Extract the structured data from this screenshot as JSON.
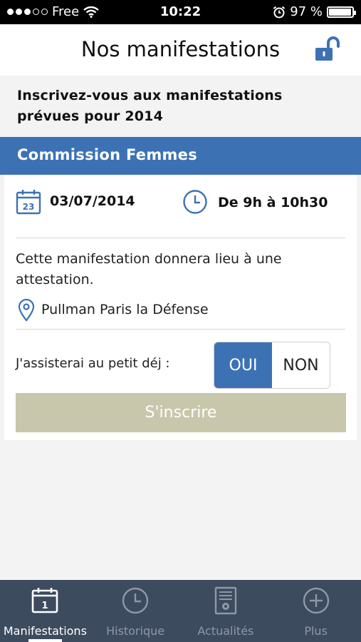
{
  "status_bar": {
    "carrier": "Free",
    "time": "10:22",
    "battery": "97 %",
    "battery_level": 0.97
  },
  "header": {
    "title": "Nos manifestations"
  },
  "intro": {
    "text": "Inscrivez-vous aux manifestations prévues pour 2014"
  },
  "section": {
    "title": "Commission Femmes"
  },
  "event": {
    "date_icon_day": "23",
    "date": "03/07/2014",
    "time": "De 9h à 10h30",
    "description": "Cette manifestation donnera lieu à une attestation.",
    "location": "Pullman Paris la Défense",
    "breakfast_label": "J'assisterai au petit déj :",
    "option_yes": "OUI",
    "option_no": "NON",
    "selected_option": "OUI",
    "register_label": "S'inscrire"
  },
  "tabs": [
    {
      "label": "Manifestations",
      "icon": "calendar-icon",
      "icon_text": "1",
      "active": true
    },
    {
      "label": "Historique",
      "icon": "clock-icon",
      "active": false
    },
    {
      "label": "Actualités",
      "icon": "news-icon",
      "active": false
    },
    {
      "label": "Plus",
      "icon": "plus-icon",
      "active": false
    }
  ],
  "colors": {
    "accent": "#3c72b4",
    "tab_bar": "#3d4b5f",
    "register_button": "#c8c7ab"
  }
}
